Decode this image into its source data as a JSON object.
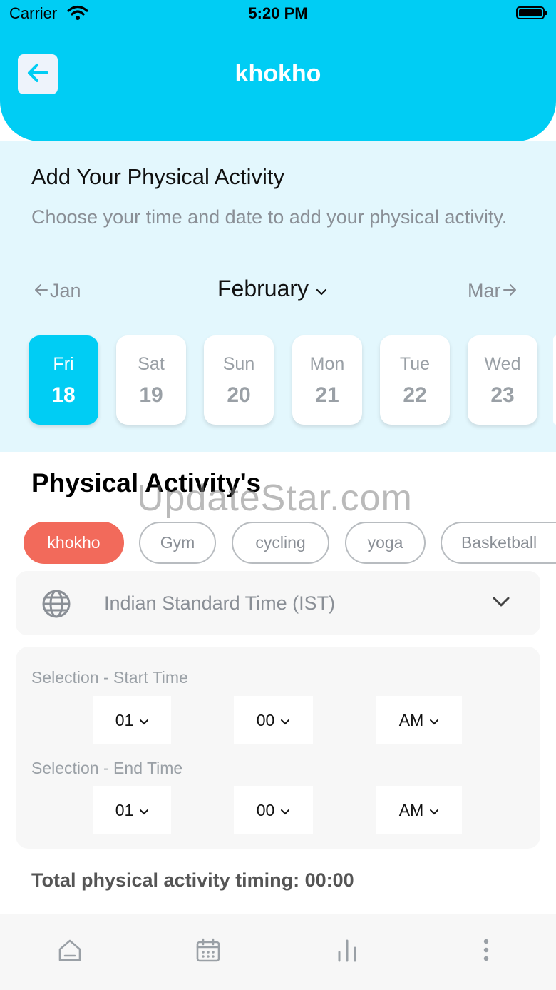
{
  "status_bar": {
    "carrier": "Carrier",
    "time": "5:20 PM"
  },
  "header": {
    "title": "khokho",
    "back_icon": "arrow-left-icon"
  },
  "activity_panel": {
    "title": "Add Your Physical Activity",
    "subtitle": "Choose your time and date to add your physical activity.",
    "prev_month": "Jan",
    "current_month": "February",
    "next_month": "Mar",
    "days": [
      {
        "name": "Fri",
        "num": "18",
        "selected": true
      },
      {
        "name": "Sat",
        "num": "19",
        "selected": false
      },
      {
        "name": "Sun",
        "num": "20",
        "selected": false
      },
      {
        "name": "Mon",
        "num": "21",
        "selected": false
      },
      {
        "name": "Tue",
        "num": "22",
        "selected": false
      },
      {
        "name": "Wed",
        "num": "23",
        "selected": false
      }
    ]
  },
  "activities": {
    "title": "Physical Activity's",
    "watermark": "UpdateStar.com",
    "chips": [
      "khokho",
      "Gym",
      "cycling",
      "yoga",
      "Basketball"
    ],
    "selected": "khokho"
  },
  "timezone": {
    "label": "Indian Standard Time (IST)",
    "icon": "globe-icon"
  },
  "start_time": {
    "label": "Selection - Start Time",
    "hour": "01",
    "minute": "00",
    "period": "AM"
  },
  "end_time": {
    "label": "Selection - End Time",
    "hour": "01",
    "minute": "00",
    "period": "AM"
  },
  "total": {
    "text": "Total physical activity timing: 00:00"
  },
  "bottom_nav": {
    "items": [
      "home-icon",
      "calendar-icon",
      "stats-icon",
      "more-icon"
    ]
  },
  "colors": {
    "accent": "#00cdf4",
    "chip_active": "#f26a5b",
    "panel_bg": "#e3f7fd"
  }
}
